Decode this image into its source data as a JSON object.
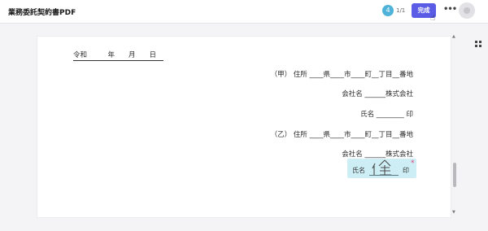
{
  "header": {
    "title": "業務委託契約書PDF",
    "page_badge": "4",
    "page_count": "1/1",
    "done_label": "完成",
    "more_label": "•••"
  },
  "document": {
    "date_line": "令和　　　年　　月　　日　",
    "party_a": {
      "address": "（甲）  住所 ____県____市____町__丁目__番地",
      "company": "会社名 ______株式会社",
      "name": "氏名 ________  印"
    },
    "party_b": {
      "address": "（乙）  住所 ____県____市____町__丁目__番地",
      "company": "会社名 ______株式会社",
      "signature_name_label": "氏名",
      "signature_seal_label": "印",
      "signature_value": "佳"
    }
  },
  "signature_required_mark": "*",
  "colors": {
    "accent": "#5b5ce6",
    "badge": "#4fb3d9",
    "signature_field": "#cdeef5",
    "required": "#e0407a"
  }
}
